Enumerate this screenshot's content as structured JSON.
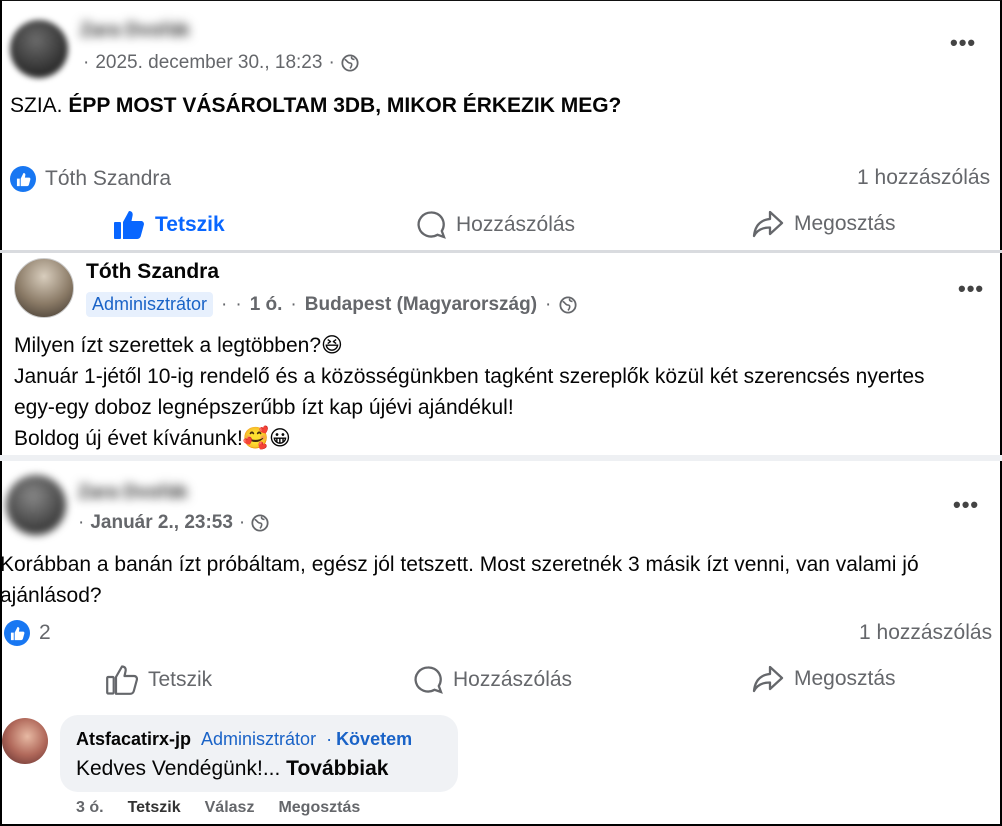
{
  "post1": {
    "author": "Zara Dvořák",
    "time": "2025. december 30., 18:23",
    "dot": "·",
    "text_prefix": "SZIA. ",
    "text_bold": "ÉPP MOST VÁSÁROLTAM 3DB, MIKOR ÉRKEZIK MEG?",
    "liker": "Tóth Szandra",
    "comment_count": "1 hozzászólás",
    "actions": {
      "like": "Tetszik",
      "comment": "Hozzászólás",
      "share": "Megosztás"
    }
  },
  "post2": {
    "author": "Tóth Szandra",
    "role": "Adminisztrátor",
    "time": "1 ó.",
    "location": "Budapest (Magyarország)",
    "dot": "·",
    "lines": [
      "Milyen ízt szerettek a legtöbben?😆",
      "Január 1-jétől 10-ig rendelő és a közösségünkben tagként szereplők közül két szerencsés nyertes",
      "egy-egy doboz legnépszerűbb ízt kap újévi ajándékul!",
      "Boldog új évet kívánunk!🥰😀"
    ]
  },
  "post3": {
    "author": "Zara Dvořák",
    "time": "Január 2., 23:53",
    "dot": "·",
    "lines": [
      "Korábban a banán ízt próbáltam, egész jól tetszett. Most szeretnék 3 másik ízt venni, van valami jó",
      "ajánlásod?"
    ],
    "like_count": "2",
    "comment_count": "1 hozzászólás",
    "actions": {
      "like": "Tetszik",
      "comment": "Hozzászólás",
      "share": "Megosztás"
    }
  },
  "reply": {
    "author": "Atsfacatirx-jp",
    "role": "Adminisztrátor",
    "follow": "Követem",
    "dot": "·",
    "text": "Kedves Vendégünk!...",
    "more": "Továbbiak",
    "time": "3 ó.",
    "like": "Tetszik",
    "answer": "Válasz",
    "share": "Megosztás"
  },
  "colors": {
    "accent": "#0866ff",
    "meta": "#65676b",
    "admin_bg": "#e7f0fd"
  },
  "icons": [
    "globe-icon",
    "more-icon",
    "like-badge-icon",
    "thumb-up-icon",
    "comment-icon",
    "share-icon"
  ]
}
